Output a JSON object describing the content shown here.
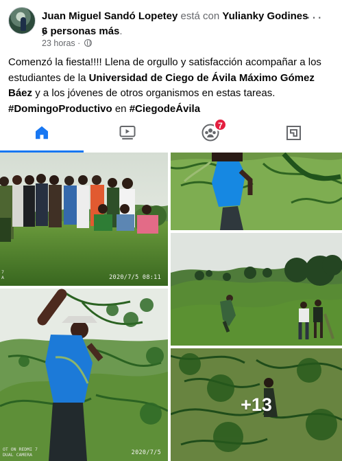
{
  "header": {
    "author": "Juan Miguel Sandó Lopetey",
    "with_text": "está con",
    "tagged": "Yulianky Godines",
    "and_text": "y",
    "others": "6 personas más",
    "period": ".",
    "time": "23 horas",
    "separator": "·",
    "privacy_icon": "globe-icon",
    "menu_icon": "more-icon"
  },
  "post": {
    "text_part1": "Comenzó la fiesta!!!! Llena de orgullo y satisfacción acompañar a los estudiantes de la ",
    "university": "Universidad de Ciego de Ávila Máximo Gómez Báez",
    "text_part2": " y a los jóvenes de otros organismos en estas tareas.",
    "hashtag1": "#DomingoProductivo",
    "connector": " en ",
    "hashtag2": "#CiegodeÁvila"
  },
  "nav": {
    "tabs": [
      {
        "name": "home",
        "icon": "home-icon",
        "active": true
      },
      {
        "name": "watch",
        "icon": "video-icon"
      },
      {
        "name": "groups",
        "icon": "groups-icon",
        "badge": "7"
      },
      {
        "name": "gaming",
        "icon": "gaming-icon"
      }
    ],
    "accent": "#1877f2"
  },
  "gallery": {
    "photo1_timestamp": "2020/7/5  08:11",
    "photo1_side_mark": "7\nA",
    "photo3_timestamp": "2020/7/5",
    "photo3_camera": "OT ON REDMI 7\nDUAL CAMERA",
    "more_count": "+13"
  }
}
